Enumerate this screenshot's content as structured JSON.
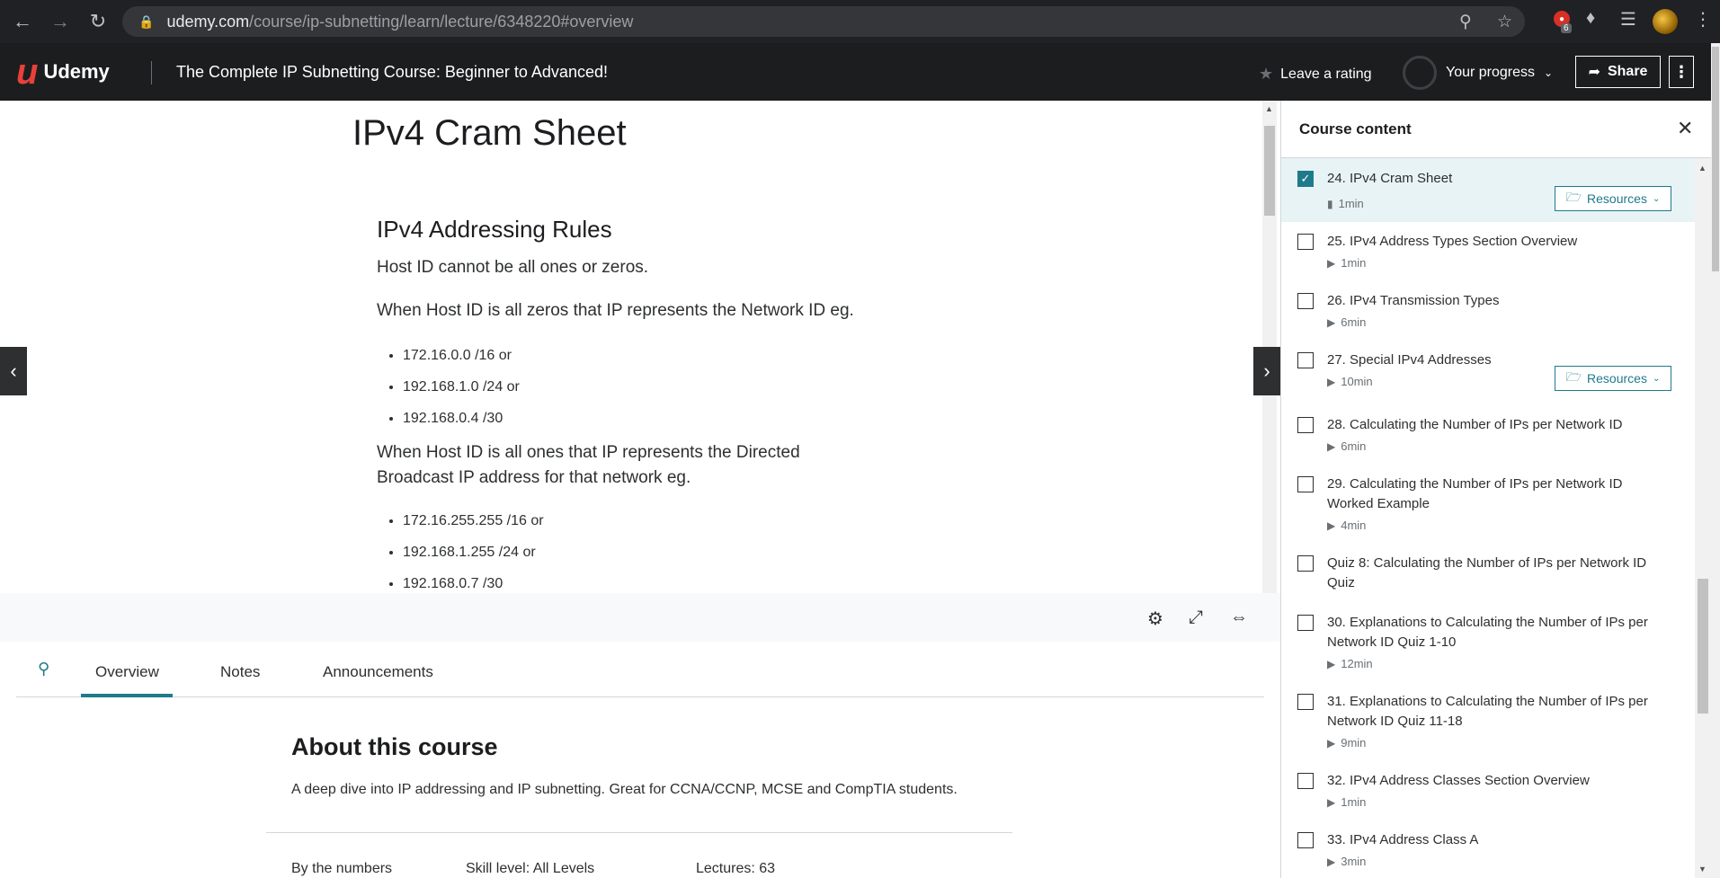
{
  "browser": {
    "url_host": "udemy.com",
    "url_path": "/course/ip-subnetting/learn/lecture/6348220#overview",
    "extension_badge": "6"
  },
  "header": {
    "logo_text": "Udemy",
    "course_title": "The Complete IP Subnetting Course: Beginner to Advanced!",
    "rating_label": "Leave a rating",
    "progress_label": "Your progress",
    "share_label": "Share"
  },
  "lecture": {
    "title": "IPv4 Cram Sheet",
    "section_heading": "IPv4 Addressing Rules",
    "para1": "Host ID cannot be all ones or zeros.",
    "para2": "When Host ID is all zeros that IP represents the Network ID eg.",
    "list1": [
      "172.16.0.0 /16 or",
      "192.168.1.0 /24 or",
      "192.168.0.4 /30"
    ],
    "para3": "When Host ID is all ones that IP represents the Directed Broadcast IP address for that network eg.",
    "list2": [
      "172.16.255.255 /16 or",
      "192.168.1.255 /24 or",
      "192.168.0.7 /30"
    ]
  },
  "tabs": {
    "overview": "Overview",
    "notes": "Notes",
    "announcements": "Announcements"
  },
  "about": {
    "title": "About this course",
    "description": "A deep dive into IP addressing and IP subnetting. Great for CCNA/CCNP, MCSE and CompTIA students.",
    "by_numbers": "By the numbers",
    "skill_level": "Skill level: All Levels",
    "lectures": "Lectures: 63"
  },
  "sidebar": {
    "title": "Course content",
    "resources_label": "Resources",
    "items": [
      {
        "title": "24. IPv4 Cram Sheet",
        "duration": "1min",
        "type": "article",
        "checked": true,
        "resources": true
      },
      {
        "title": "25. IPv4 Address Types Section Overview",
        "duration": "1min",
        "type": "video"
      },
      {
        "title": "26. IPv4 Transmission Types",
        "duration": "6min",
        "type": "video"
      },
      {
        "title": "27. Special IPv4 Addresses",
        "duration": "10min",
        "type": "video",
        "resources": true
      },
      {
        "title": "28. Calculating the Number of IPs per Network ID",
        "duration": "6min",
        "type": "video"
      },
      {
        "title": "29. Calculating the Number of IPs per Network ID Worked Example",
        "duration": "4min",
        "type": "video"
      },
      {
        "title": "Quiz 8: Calculating the Number of IPs per Network ID Quiz",
        "duration": "",
        "type": "quiz"
      },
      {
        "title": "30. Explanations to Calculating the Number of IPs per Network ID Quiz 1-10",
        "duration": "12min",
        "type": "video"
      },
      {
        "title": "31. Explanations to Calculating the Number of IPs per Network ID Quiz 11-18",
        "duration": "9min",
        "type": "video"
      },
      {
        "title": "32. IPv4 Address Classes Section Overview",
        "duration": "1min",
        "type": "video"
      },
      {
        "title": "33. IPv4 Address Class A",
        "duration": "3min",
        "type": "video"
      }
    ]
  }
}
